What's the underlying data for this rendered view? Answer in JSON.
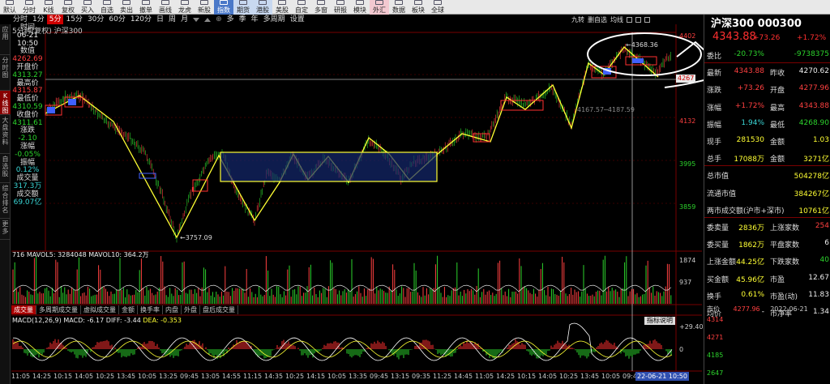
{
  "toolbar": {
    "items": [
      {
        "label": "默认",
        "style": ""
      },
      {
        "label": "分时",
        "style": ""
      },
      {
        "label": "K线",
        "style": ""
      },
      {
        "label": "复权",
        "style": ""
      },
      {
        "label": "买入",
        "style": ""
      },
      {
        "label": "自选",
        "style": ""
      },
      {
        "label": "卖出",
        "style": ""
      },
      {
        "label": "撤单",
        "style": ""
      },
      {
        "label": "画线",
        "style": ""
      },
      {
        "label": "龙虎",
        "style": ""
      },
      {
        "label": "新股",
        "style": ""
      },
      {
        "label": "指数",
        "style": "hi"
      },
      {
        "label": "期货",
        "style": "blue"
      },
      {
        "label": "港股",
        "style": "blue"
      },
      {
        "label": "美股",
        "style": ""
      },
      {
        "label": "自定",
        "style": ""
      },
      {
        "label": "多窗",
        "style": ""
      },
      {
        "label": "研报",
        "style": ""
      },
      {
        "label": "模块",
        "style": ""
      },
      {
        "label": "外汇",
        "style": "pink"
      },
      {
        "label": "数据",
        "style": ""
      },
      {
        "label": "板块",
        "style": ""
      },
      {
        "label": "全球",
        "style": ""
      }
    ]
  },
  "periods": [
    "分时",
    "1分",
    "5分",
    "15分",
    "30分",
    "60分",
    "120分",
    "日",
    "周",
    "月",
    "多",
    "季",
    "年",
    "多周期",
    "设置"
  ],
  "periods_active": "5分",
  "right_tools": [
    "九转",
    "删自选",
    "均线"
  ],
  "vtabs": [
    {
      "label": "应用",
      "active": false
    },
    {
      "label": "分时图",
      "active": false
    },
    {
      "label": "K线图",
      "active": true
    },
    {
      "label": "大盘资料",
      "active": false
    },
    {
      "label": "自选股",
      "active": false
    },
    {
      "label": "综合排名",
      "active": false
    },
    {
      "label": "更多",
      "active": false
    }
  ],
  "stock_title": "5分钟(复权) 沪深300",
  "info": [
    {
      "label": "时间",
      "value": "06-21",
      "cls": "c-white"
    },
    {
      "label": "",
      "value": "10:50",
      "cls": "c-white"
    },
    {
      "label": "数值",
      "value": "4262.69",
      "cls": "c-red"
    },
    {
      "label": "开盘价",
      "value": "4313.27",
      "cls": "c-green"
    },
    {
      "label": "最高价",
      "value": "4315.87",
      "cls": "c-red"
    },
    {
      "label": "最低价",
      "value": "4310.59",
      "cls": "c-green"
    },
    {
      "label": "收盘价",
      "value": "4311.61",
      "cls": "c-green"
    },
    {
      "label": "涨跌",
      "value": "-2.10",
      "cls": "c-green"
    },
    {
      "label": "涨幅",
      "value": "-0.05%",
      "cls": "c-green"
    },
    {
      "label": "振幅",
      "value": "0.12%",
      "cls": "c-cyan"
    },
    {
      "label": "成交量",
      "value": "317.3万",
      "cls": "c-cyan"
    },
    {
      "label": "成交额",
      "value": "69.07亿",
      "cls": "c-cyan"
    }
  ],
  "price_axis": [
    "4402",
    "4267",
    "4132",
    "3995",
    "3859"
  ],
  "price_axis_colors": [
    "#ff4040",
    "#ffffff",
    "#ff4040",
    "#2cd32c",
    "#2cd32c"
  ],
  "current_price_tag": "4267",
  "annotations": {
    "low": "3757.09",
    "high": "4368.36",
    "mid": "4167.57",
    "mid2": "4187.59",
    "letter": "B"
  },
  "volume": {
    "legend": "716  MAVOL5: 3284048  MAVOL10: 364.2万",
    "axis_top": "1874",
    "axis_mid": "937"
  },
  "bottom_tabs": [
    {
      "label": "成交量",
      "active": true
    },
    {
      "label": "多周期成交量",
      "active": false
    },
    {
      "label": "虚拟成交量",
      "active": false
    },
    {
      "label": "金额",
      "active": false
    },
    {
      "label": "换手率",
      "active": false
    },
    {
      "label": "内盘",
      "active": false
    },
    {
      "label": "外盘",
      "active": false
    },
    {
      "label": "盘后成交量",
      "active": false
    }
  ],
  "macd": {
    "legend_name": "MACD(12,26,9)",
    "legend_macd": "MACD: -6.17",
    "legend_diff": "DIFF: -3.44",
    "legend_dea": "DEA: -0.353",
    "help": "指标说明",
    "axis_top": "+29.40",
    "axis_zero": "0"
  },
  "time_axis": [
    "11:05",
    "14:25",
    "10:15",
    "14:05",
    "10:25",
    "13:45",
    "10:05",
    "13:25",
    "09:45",
    "13:05",
    "14:55",
    "11:15",
    "14:35",
    "10:25",
    "14:15",
    "10:05",
    "13:35",
    "09:45",
    "13:15",
    "09:35",
    "11:25",
    "14:45",
    "11:05",
    "14:25",
    "10:15",
    "14:05",
    "10:25",
    "13:45",
    "10:05",
    "09:45"
  ],
  "time_highlight": "22-06-21 10:50",
  "right_panel": {
    "title": "沪深300  000300",
    "price": "4343.88",
    "change": "+73.26",
    "pct": "+1.72%",
    "rows": [
      {
        "l1": "委比",
        "v1": "-20.73%",
        "c1": "c-green",
        "l2": "",
        "v2": "-9738375",
        "c2": "c-green"
      },
      {
        "l1": "最新",
        "v1": "4343.88",
        "c1": "c-red",
        "l2": "昨收",
        "v2": "4270.62",
        "c2": "c-white"
      },
      {
        "l1": "涨跌",
        "v1": "+73.26",
        "c1": "c-red",
        "l2": "开盘",
        "v2": "4277.96",
        "c2": "c-red"
      },
      {
        "l1": "涨幅",
        "v1": "+1.72%",
        "c1": "c-red",
        "l2": "最高",
        "v2": "4343.88",
        "c2": "c-red"
      },
      {
        "l1": "振幅",
        "v1": "1.94%",
        "c1": "c-cyan",
        "l2": "最低",
        "v2": "4268.90",
        "c2": "c-green"
      },
      {
        "l1": "现手",
        "v1": "281530",
        "c1": "c-yel",
        "l2": "金额",
        "v2": "1.03",
        "c2": "c-yel"
      },
      {
        "l1": "总手",
        "v1": "17088万",
        "c1": "c-yel",
        "l2": "金额",
        "v2": "3271亿",
        "c2": "c-yel"
      },
      {
        "l1": "总市值",
        "v1": "",
        "c1": "c-white",
        "l2": "",
        "v2": "504278亿",
        "c2": "c-yel"
      },
      {
        "l1": "流通市值",
        "v1": "",
        "c1": "c-white",
        "l2": "",
        "v2": "384267亿",
        "c2": "c-yel"
      },
      {
        "l1": "两市成交额(沪市+深市)",
        "v1": "",
        "c1": "c-white",
        "l2": "",
        "v2": "10761亿",
        "c2": "c-yel"
      },
      {
        "l1": "委卖量",
        "v1": "2836万",
        "c1": "c-yel",
        "l2": "上涨家数",
        "v2": "254",
        "c2": "c-red"
      },
      {
        "l1": "委买量",
        "v1": "1862万",
        "c1": "c-yel",
        "l2": "平盘家数",
        "v2": "6",
        "c2": "c-white"
      },
      {
        "l1": "上涨金额",
        "v1": "44.25亿",
        "c1": "c-yel",
        "l2": "下跌家数",
        "v2": "40",
        "c2": "c-green"
      },
      {
        "l1": "买金额",
        "v1": "45.96亿",
        "c1": "c-yel",
        "l2": "市盈",
        "v2": "12.67",
        "c2": "c-white"
      },
      {
        "l1": "换手",
        "v1": "0.61%",
        "c1": "c-yel",
        "l2": "市盈(动)",
        "v2": "11.83",
        "c2": "c-white"
      },
      {
        "l1": "均价",
        "v1": "-",
        "c1": "c-white",
        "l2": "市净率",
        "v2": "1.34",
        "c2": "c-white"
      }
    ],
    "mini_left": "市价",
    "mini_mid": "4277.96",
    "mini_date": "2022-06-21",
    "mini_axis": [
      "4314",
      "4271",
      "4185",
      "2647"
    ]
  }
}
